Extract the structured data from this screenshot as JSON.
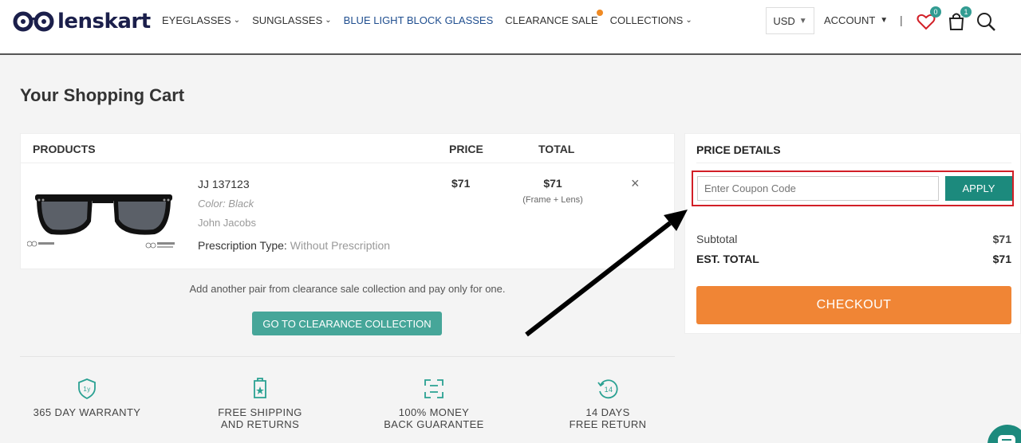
{
  "brand": {
    "name": "lenskart"
  },
  "nav": {
    "items": [
      {
        "label": "EYEGLASSES",
        "has_dropdown": true
      },
      {
        "label": "SUNGLASSES",
        "has_dropdown": true
      },
      {
        "label": "BLUE LIGHT BLOCK GLASSES",
        "has_dropdown": false
      },
      {
        "label": "CLEARANCE SALE",
        "has_dropdown": false
      },
      {
        "label": "COLLECTIONS",
        "has_dropdown": true
      }
    ],
    "currency": "USD",
    "account": "ACCOUNT",
    "separator": "|",
    "wishlist_count": "0",
    "cart_count": "1"
  },
  "page": {
    "title": "Your Shopping Cart"
  },
  "cart": {
    "headers": {
      "products": "PRODUCTS",
      "price": "PRICE",
      "total": "TOTAL"
    },
    "item": {
      "name": "JJ 137123",
      "color": "Color: Black",
      "brand": "John Jacobs",
      "rx_label": "Prescription Type:",
      "rx_value": "Without Prescription",
      "price": "$71",
      "total": "$71",
      "total_note": "(Frame + Lens)",
      "remove": "×"
    },
    "promo": "Add another pair from clearance sale collection and pay only for one.",
    "clearance_button": "GO TO CLEARANCE COLLECTION"
  },
  "features": [
    {
      "line1": "365 DAY WARRANTY",
      "line2": "",
      "icon": "warranty-shield-icon"
    },
    {
      "line1": "FREE SHIPPING",
      "line2": "AND RETURNS",
      "icon": "shipping-tag-icon"
    },
    {
      "line1": "100% MONEY",
      "line2": "BACK GUARANTEE",
      "icon": "money-back-icon"
    },
    {
      "line1": "14 DAYS",
      "line2": "FREE RETURN",
      "icon": "return-days-icon"
    }
  ],
  "price_details": {
    "title": "PRICE DETAILS",
    "coupon_placeholder": "Enter Coupon Code",
    "apply": "APPLY",
    "subtotal_label": "Subtotal",
    "subtotal": "$71",
    "est_total_label": "EST. TOTAL",
    "est_total": "$71",
    "checkout": "CHECKOUT"
  },
  "colors": {
    "teal": "#1c8a7d",
    "orange": "#f08535",
    "highlight_red": "#d21f27",
    "navy": "#1b1f4b"
  }
}
